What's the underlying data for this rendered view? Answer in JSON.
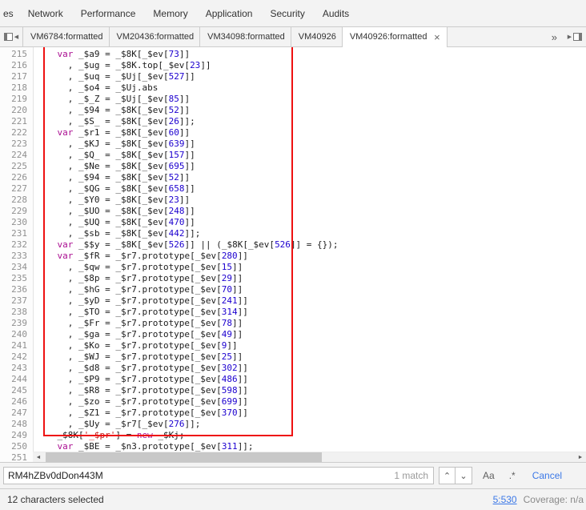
{
  "annotation": {
    "shape": "rectangle",
    "color": "#ee1111"
  },
  "panel_tabs": {
    "partial": "es",
    "tabs": [
      {
        "label": "Network"
      },
      {
        "label": "Performance"
      },
      {
        "label": "Memory"
      },
      {
        "label": "Application"
      },
      {
        "label": "Security"
      },
      {
        "label": "Audits"
      }
    ]
  },
  "file_tabs": {
    "nav_left_icon": "◀",
    "nav_right_icon": "▶",
    "overflow_label": "»",
    "tabs": [
      {
        "label": "VM6784:formatted",
        "active": false,
        "closable": false
      },
      {
        "label": "VM20436:formatted",
        "active": false,
        "closable": false
      },
      {
        "label": "VM34098:formatted",
        "active": false,
        "closable": false
      },
      {
        "label": "VM40926",
        "active": false,
        "closable": false
      },
      {
        "label": "VM40926:formatted",
        "active": true,
        "closable": true
      }
    ],
    "close_icon": "×"
  },
  "editor": {
    "lines": [
      {
        "num": 215,
        "code": "    var _$a9 = _$8K[_$ev[73]]"
      },
      {
        "num": 216,
        "code": "      , _$ug = _$8K.top[_$ev[23]]"
      },
      {
        "num": 217,
        "code": "      , _$uq = _$Uj[_$ev[527]]"
      },
      {
        "num": 218,
        "code": "      , _$o4 = _$Uj.abs"
      },
      {
        "num": 219,
        "code": "      , _$_Z = _$Uj[_$ev[85]]"
      },
      {
        "num": 220,
        "code": "      , _$94 = _$8K[_$ev[52]]"
      },
      {
        "num": 221,
        "code": "      , _$S_ = _$8K[_$ev[26]];"
      },
      {
        "num": 222,
        "code": "    var _$r1 = _$8K[_$ev[60]]"
      },
      {
        "num": 223,
        "code": "      , _$KJ = _$8K[_$ev[639]]"
      },
      {
        "num": 224,
        "code": "      , _$Q_ = _$8K[_$ev[157]]"
      },
      {
        "num": 225,
        "code": "      , _$Ne = _$8K[_$ev[695]]"
      },
      {
        "num": 226,
        "code": "      , _$94 = _$8K[_$ev[52]]"
      },
      {
        "num": 227,
        "code": "      , _$QG = _$8K[_$ev[658]]"
      },
      {
        "num": 228,
        "code": "      , _$Y0 = _$8K[_$ev[23]]"
      },
      {
        "num": 229,
        "code": "      , _$UO = _$8K[_$ev[248]]"
      },
      {
        "num": 230,
        "code": "      , _$UQ = _$8K[_$ev[470]]"
      },
      {
        "num": 231,
        "code": "      , _$sb = _$8K[_$ev[442]];"
      },
      {
        "num": 232,
        "code": "    var _$$y = _$8K[_$ev[526]] || (_$8K[_$ev[526]] = {});"
      },
      {
        "num": 233,
        "code": "    var _$fR = _$r7.prototype[_$ev[280]]"
      },
      {
        "num": 234,
        "code": "      , _$qw = _$r7.prototype[_$ev[15]]"
      },
      {
        "num": 235,
        "code": "      , _$8p = _$r7.prototype[_$ev[29]]"
      },
      {
        "num": 236,
        "code": "      , _$hG = _$r7.prototype[_$ev[70]]"
      },
      {
        "num": 237,
        "code": "      , _$yD = _$r7.prototype[_$ev[241]]"
      },
      {
        "num": 238,
        "code": "      , _$TO = _$r7.prototype[_$ev[314]]"
      },
      {
        "num": 239,
        "code": "      , _$Fr = _$r7.prototype[_$ev[78]]"
      },
      {
        "num": 240,
        "code": "      , _$ga = _$r7.prototype[_$ev[49]]"
      },
      {
        "num": 241,
        "code": "      , _$Ko = _$r7.prototype[_$ev[9]]"
      },
      {
        "num": 242,
        "code": "      , _$WJ = _$r7.prototype[_$ev[25]]"
      },
      {
        "num": 243,
        "code": "      , _$d8 = _$r7.prototype[_$ev[302]]"
      },
      {
        "num": 244,
        "code": "      , _$P9 = _$r7.prototype[_$ev[486]]"
      },
      {
        "num": 245,
        "code": "      , _$R8 = _$r7.prototype[_$ev[598]]"
      },
      {
        "num": 246,
        "code": "      , _$zo = _$r7.prototype[_$ev[699]]"
      },
      {
        "num": 247,
        "code": "      , _$Z1 = _$r7.prototype[_$ev[370]]"
      },
      {
        "num": 248,
        "code": "      , _$Uy = _$r7[_$ev[276]];"
      },
      {
        "num": 249,
        "code": "    _$8K['_$pr'] = new _$Kj;"
      },
      {
        "num": 250,
        "code": "    var _$BE = _$n3.prototype[_$ev[311]];"
      },
      {
        "num": 251,
        "code": ""
      }
    ]
  },
  "scrollbar": {
    "left_icon": "◄",
    "right_icon": "►"
  },
  "search": {
    "query": "RM4hZBv0dDon443M",
    "match_count": "1 match",
    "prev_icon": "⌃",
    "next_icon": "⌄",
    "case_toggle": "Aa",
    "regex_toggle": ".*",
    "cancel_label": "Cancel"
  },
  "status": {
    "selection_info": "12 characters selected",
    "cursor_position": "5:530",
    "coverage": "Coverage: n/a"
  }
}
